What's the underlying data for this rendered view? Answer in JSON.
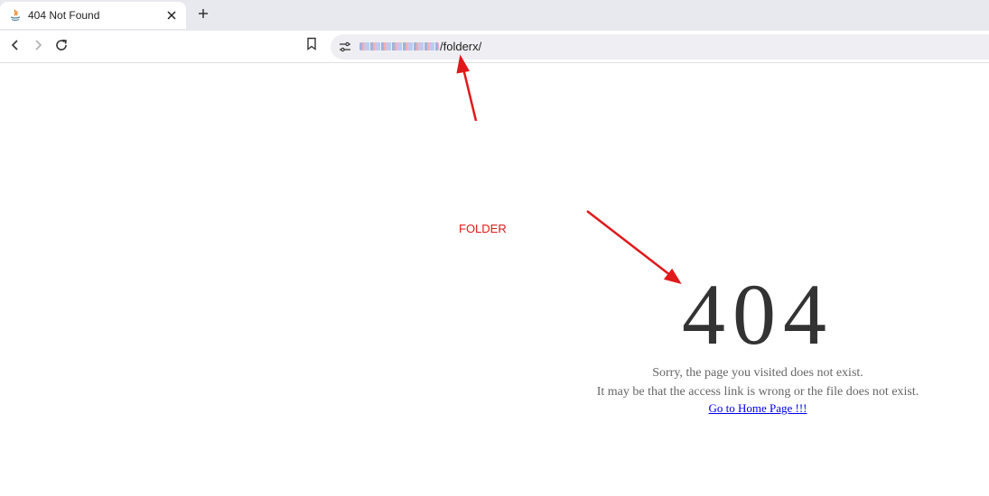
{
  "tab": {
    "title": "404 Not Found",
    "favicon": "java-cup-icon",
    "close_icon": "close-icon"
  },
  "toolbar": {
    "new_tab_icon": "plus-icon",
    "back_icon": "arrow-left-icon",
    "forward_icon": "arrow-right-icon",
    "reload_icon": "reload-icon",
    "bookmark_icon": "bookmark-icon",
    "site_info_icon": "tune-icon"
  },
  "address_bar": {
    "host_redacted": true,
    "path": "/folderx/"
  },
  "annotation": {
    "label": "FOLDER",
    "color": "#e0191b"
  },
  "error_page": {
    "code": "404",
    "message_line1": "Sorry, the page you visited does not exist.",
    "message_line2": "It may be that the access link is wrong or the file does not exist.",
    "home_link": "Go to Home Page !!!"
  }
}
